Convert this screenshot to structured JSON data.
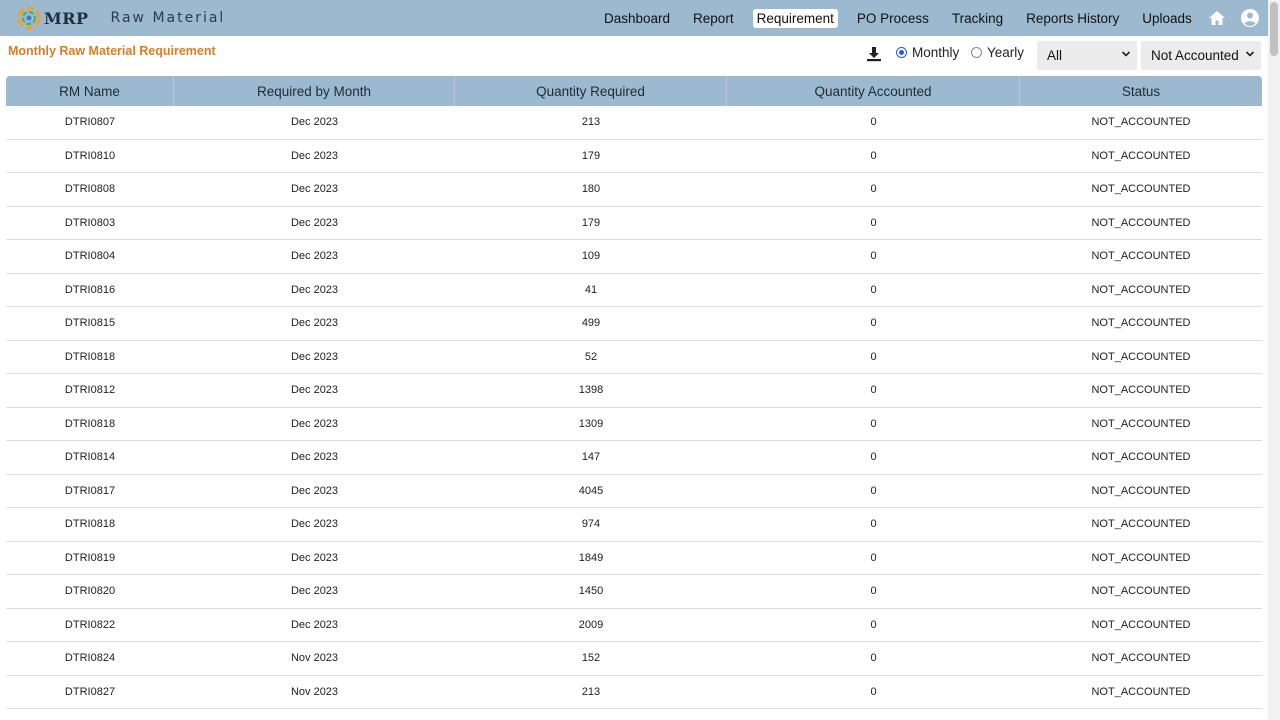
{
  "brand": {
    "logo_text": "MRP",
    "app_title": "Raw Material"
  },
  "nav": {
    "links": [
      "Dashboard",
      "Report",
      "Requirement",
      "PO Process",
      "Tracking",
      "Reports History",
      "Uploads"
    ],
    "active": "Requirement",
    "icons": [
      "home-icon",
      "user-account-icon"
    ]
  },
  "toolbar": {
    "heading": "Monthly Raw Material Requirement",
    "download_icon": "download-icon",
    "radio_monthly": "Monthly",
    "radio_yearly": "Yearly",
    "selected_period": "Monthly",
    "filter_select": "All",
    "status_select": "Not Accounted"
  },
  "table": {
    "headers": [
      "RM Name",
      "Required by Month",
      "Quantity Required",
      "Quantity Accounted",
      "Status"
    ],
    "rows": [
      [
        "DTRI0807",
        "Dec 2023",
        "213",
        "0",
        "NOT_ACCOUNTED"
      ],
      [
        "DTRI0810",
        "Dec 2023",
        "179",
        "0",
        "NOT_ACCOUNTED"
      ],
      [
        "DTRI0808",
        "Dec 2023",
        "180",
        "0",
        "NOT_ACCOUNTED"
      ],
      [
        "DTRI0803",
        "Dec 2023",
        "179",
        "0",
        "NOT_ACCOUNTED"
      ],
      [
        "DTRI0804",
        "Dec 2023",
        "109",
        "0",
        "NOT_ACCOUNTED"
      ],
      [
        "DTRI0816",
        "Dec 2023",
        "41",
        "0",
        "NOT_ACCOUNTED"
      ],
      [
        "DTRI0815",
        "Dec 2023",
        "499",
        "0",
        "NOT_ACCOUNTED"
      ],
      [
        "DTRI0818",
        "Dec 2023",
        "52",
        "0",
        "NOT_ACCOUNTED"
      ],
      [
        "DTRI0812",
        "Dec 2023",
        "1398",
        "0",
        "NOT_ACCOUNTED"
      ],
      [
        "DTRI0818",
        "Dec 2023",
        "1309",
        "0",
        "NOT_ACCOUNTED"
      ],
      [
        "DTRI0814",
        "Dec 2023",
        "147",
        "0",
        "NOT_ACCOUNTED"
      ],
      [
        "DTRI0817",
        "Dec 2023",
        "4045",
        "0",
        "NOT_ACCOUNTED"
      ],
      [
        "DTRI0818",
        "Dec 2023",
        "974",
        "0",
        "NOT_ACCOUNTED"
      ],
      [
        "DTRI0819",
        "Dec 2023",
        "1849",
        "0",
        "NOT_ACCOUNTED"
      ],
      [
        "DTRI0820",
        "Dec 2023",
        "1450",
        "0",
        "NOT_ACCOUNTED"
      ],
      [
        "DTRI0822",
        "Dec 2023",
        "2009",
        "0",
        "NOT_ACCOUNTED"
      ],
      [
        "DTRI0824",
        "Nov 2023",
        "152",
        "0",
        "NOT_ACCOUNTED"
      ],
      [
        "DTRI0827",
        "Nov 2023",
        "213",
        "0",
        "NOT_ACCOUNTED"
      ]
    ]
  },
  "colors": {
    "nav_bg": "#9cb9cf",
    "heading": "#e07b20",
    "radio_accent": "#2a5bd7"
  }
}
